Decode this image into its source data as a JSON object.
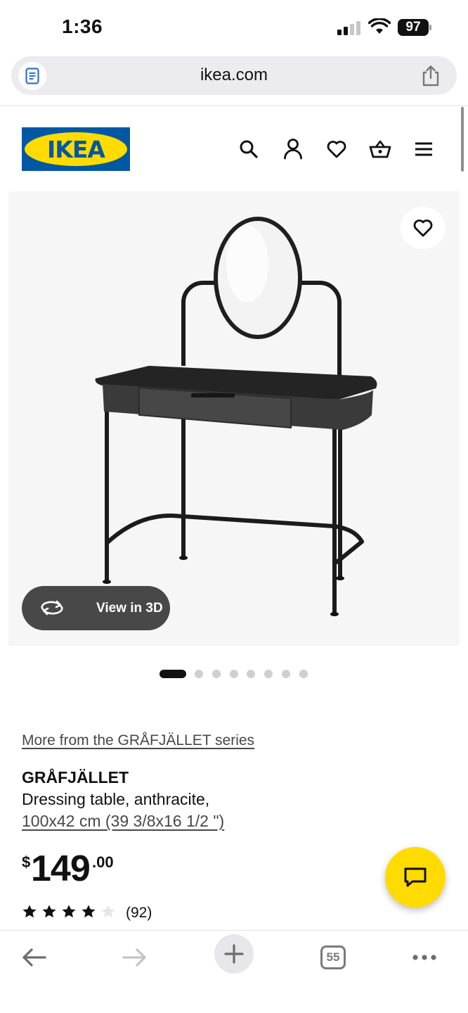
{
  "status_bar": {
    "time": "1:36",
    "battery": "97"
  },
  "browser": {
    "url": "ikea.com",
    "tab_count": "55"
  },
  "brand": {
    "logo_text": "IKEA",
    "colors": {
      "blue": "#0058a3",
      "yellow": "#ffdb00"
    }
  },
  "header": {
    "icons": [
      "search-icon",
      "account-icon",
      "favourites-icon",
      "basket-icon",
      "menu-icon"
    ]
  },
  "gallery": {
    "view_3d_label": "View in 3D",
    "image_count": 8,
    "active_index": 0
  },
  "product": {
    "series_link": "More from the GRÅFJÄLLET series",
    "name": "GRÅFJÄLLET",
    "description": "Dressing table, anthracite,",
    "size": "100x42 cm (39 3/8x16 1/2 \")",
    "price": {
      "currency": "$",
      "whole": "149",
      "cents": ".00"
    },
    "rating": {
      "stars": 4,
      "max": 5,
      "count": "(92)"
    }
  },
  "toolbar": {
    "icons": [
      "back-icon",
      "forward-icon",
      "new-tab-icon",
      "tabs-icon",
      "more-icon"
    ]
  }
}
